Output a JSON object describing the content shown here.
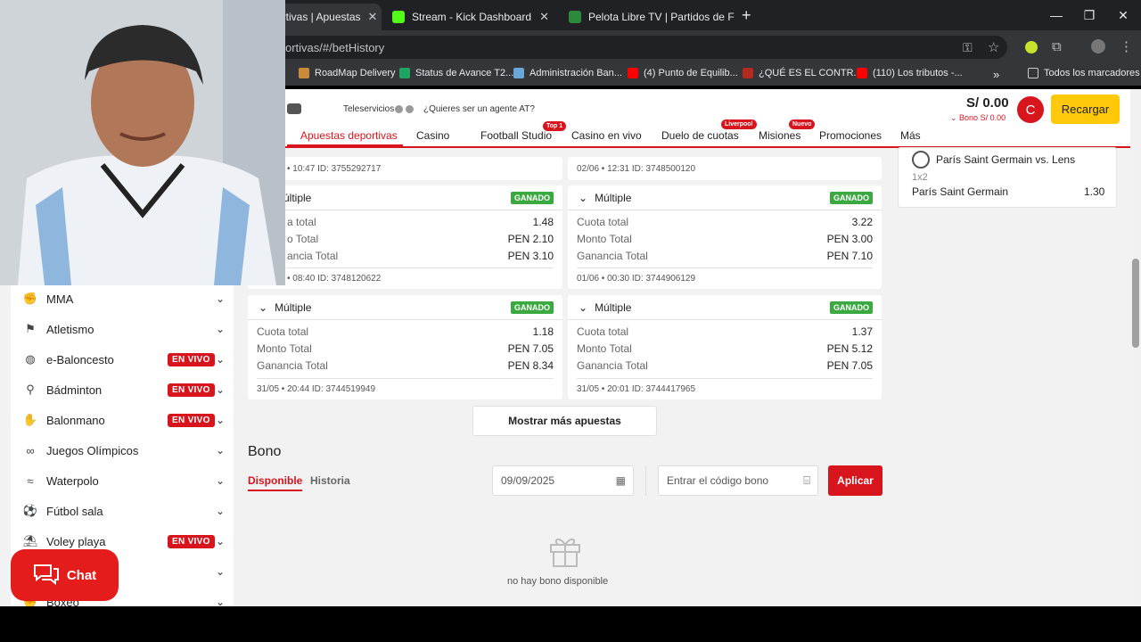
{
  "browser": {
    "tabs": [
      {
        "title": "ortivas | Apuestas"
      },
      {
        "title": "Stream - Kick Dashboard"
      },
      {
        "title": "Pelota Libre TV | Partidos de Fú"
      }
    ],
    "new_tab": "+",
    "url": "ortivas/#/betHistory",
    "bookmarks": [
      "RoadMap Delivery",
      "Status de Avance T2...",
      "Administración Ban...",
      "(4) Punto de Equilib...",
      "¿QUÉ ES EL CONTR...",
      "(110) Los tributos -..."
    ],
    "more_bookmarks": "»",
    "all_bookmarks": "Todos los marcadores"
  },
  "header": {
    "teleservicios": "Teleservicios",
    "agente": "¿Quieres ser un agente AT?",
    "balance": "S/ 0.00",
    "bono": "Bono S/ 0.00",
    "avatar_letter": "C",
    "recargar": "Recargar",
    "nav": [
      {
        "label": "Apuestas deportivas",
        "badge": ""
      },
      {
        "label": "Casino",
        "badge": ""
      },
      {
        "label": "Football Studio",
        "badge": "Top 1"
      },
      {
        "label": "Casino en vivo",
        "badge": ""
      },
      {
        "label": "Duelo de cuotas",
        "badge": "Liverpool"
      },
      {
        "label": "Misiones",
        "badge": "Nuevo"
      },
      {
        "label": "Promociones",
        "badge": ""
      },
      {
        "label": "Más",
        "badge": ""
      }
    ]
  },
  "sidebar": {
    "live_label": "EN VIVO",
    "items": [
      {
        "label": "MMA",
        "live": false
      },
      {
        "label": "Atletismo",
        "live": false
      },
      {
        "label": "e-Baloncesto",
        "live": true
      },
      {
        "label": "Bádminton",
        "live": true
      },
      {
        "label": "Balonmano",
        "live": true
      },
      {
        "label": "Juegos Olímpicos",
        "live": false
      },
      {
        "label": "Waterpolo",
        "live": false
      },
      {
        "label": "Fútbol sala",
        "live": false
      },
      {
        "label": "Voley playa",
        "live": true
      },
      {
        "label": "",
        "live": false
      },
      {
        "label": "Boxeo",
        "live": false
      }
    ]
  },
  "bets": {
    "top_left_footer": "• 10:47   ID: 3755292717",
    "top_right_footer": "02/06 • 12:31   ID: 3748500120",
    "status": "GANADO",
    "type": "Múltiple",
    "labels": {
      "cuota": "Cuota total",
      "monto": "Monto Total",
      "ganancia": "Ganancia Total"
    },
    "cards": [
      {
        "title": "últiple",
        "cuota_label": "a total",
        "monto_label": "o Total",
        "ganancia_label": "ancia Total",
        "cuota": "1.48",
        "monto": "PEN 2.10",
        "ganancia": "PEN 3.10",
        "footer": "• 08:40   ID: 3748120622"
      },
      {
        "title": "Múltiple",
        "cuota_label": "Cuota total",
        "monto_label": "Monto Total",
        "ganancia_label": "Ganancia Total",
        "cuota": "3.22",
        "monto": "PEN 3.00",
        "ganancia": "PEN 7.10",
        "footer": "01/06 • 00:30   ID: 3744906129"
      },
      {
        "title": "Múltiple",
        "cuota_label": "Cuota total",
        "monto_label": "Monto Total",
        "ganancia_label": "Ganancia Total",
        "cuota": "1.18",
        "monto": "PEN 7.05",
        "ganancia": "PEN 8.34",
        "footer": "31/05 • 20:44   ID: 3744519949"
      },
      {
        "title": "Múltiple",
        "cuota_label": "Cuota total",
        "monto_label": "Monto Total",
        "ganancia_label": "Ganancia Total",
        "cuota": "1.37",
        "monto": "PEN 5.12",
        "ganancia": "PEN 7.05",
        "footer": "31/05 • 20:01   ID: 3744417965"
      }
    ],
    "more_button": "Mostrar más apuestas"
  },
  "bono": {
    "title": "Bono",
    "tab_disponible": "Disponible",
    "tab_historia": "Historia",
    "date": "09/09/2025",
    "code_placeholder": "Entrar el código bono",
    "apply": "Aplicar",
    "empty": "no hay bono disponible"
  },
  "betslip": {
    "match": "París Saint Germain vs. Lens",
    "market": "1x2",
    "selection": "París Saint Germain",
    "odds": "1.30"
  },
  "chat": {
    "label": "Chat"
  },
  "colors": {
    "brand_red": "#d8141d",
    "won_green": "#3aa940",
    "recargar_yellow": "#ffc90a"
  }
}
